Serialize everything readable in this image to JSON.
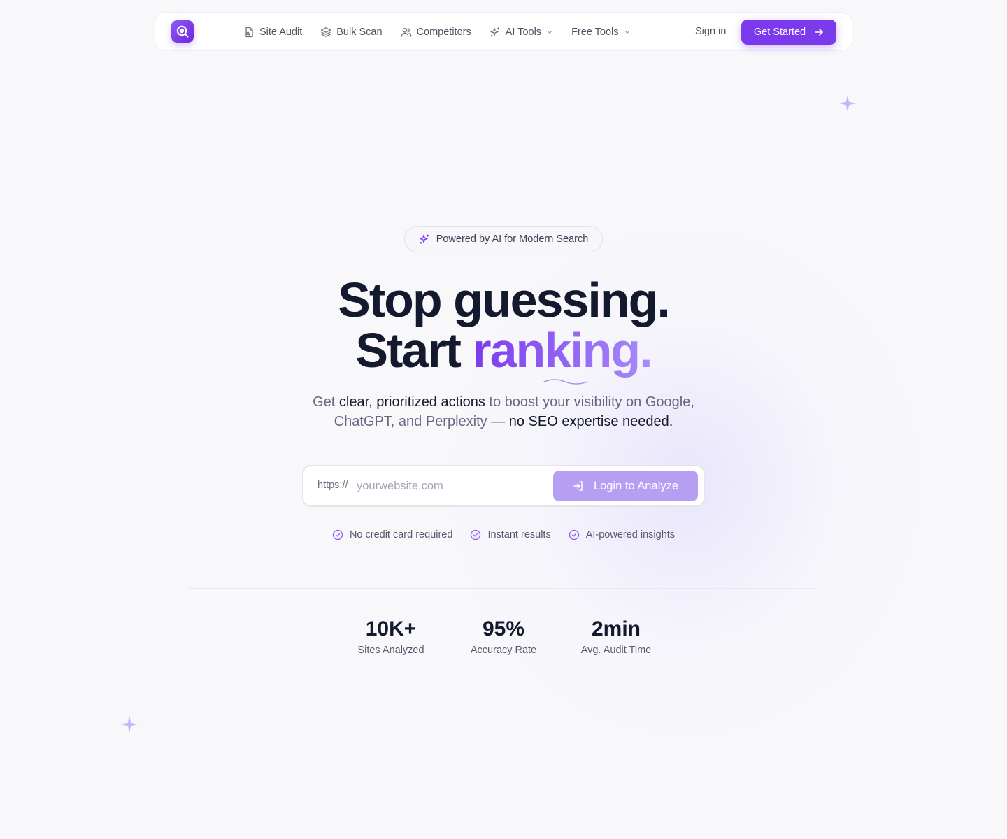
{
  "nav": {
    "logo_icon": "search-analytics-icon",
    "links": [
      {
        "label": "Site Audit",
        "icon": "file-search-icon"
      },
      {
        "label": "Bulk Scan",
        "icon": "layers-icon"
      },
      {
        "label": "Competitors",
        "icon": "users-icon"
      },
      {
        "label": "AI Tools",
        "icon": "sparkles-icon",
        "dropdown": true
      },
      {
        "label": "Free Tools",
        "dropdown": true
      }
    ],
    "sign_in": "Sign in",
    "get_started": "Get Started"
  },
  "hero": {
    "badge": "Powered by AI for Modern Search",
    "headline_line1": "Stop guessing.",
    "headline_line2_plain": "Start ",
    "headline_line2_accent": "ranking.",
    "sub_part1": "Get ",
    "sub_em1": "clear, prioritized actions",
    "sub_part2": " to boost your visibility on Google,",
    "sub_part3": "ChatGPT, and Perplexity — ",
    "sub_em2": "no SEO expertise needed."
  },
  "search": {
    "prefix": "https://",
    "placeholder": "yourwebsite.com",
    "button": "Login to Analyze"
  },
  "checks": [
    "No credit card required",
    "Instant results",
    "AI-powered insights"
  ],
  "stats": [
    {
      "value": "10K+",
      "label": "Sites Analyzed"
    },
    {
      "value": "95%",
      "label": "Accuracy Rate"
    },
    {
      "value": "2min",
      "label": "Avg. Audit Time"
    }
  ],
  "colors": {
    "accent": "#7c3aed",
    "accent_light": "#b69ff3",
    "text_dark": "#131a2d"
  }
}
